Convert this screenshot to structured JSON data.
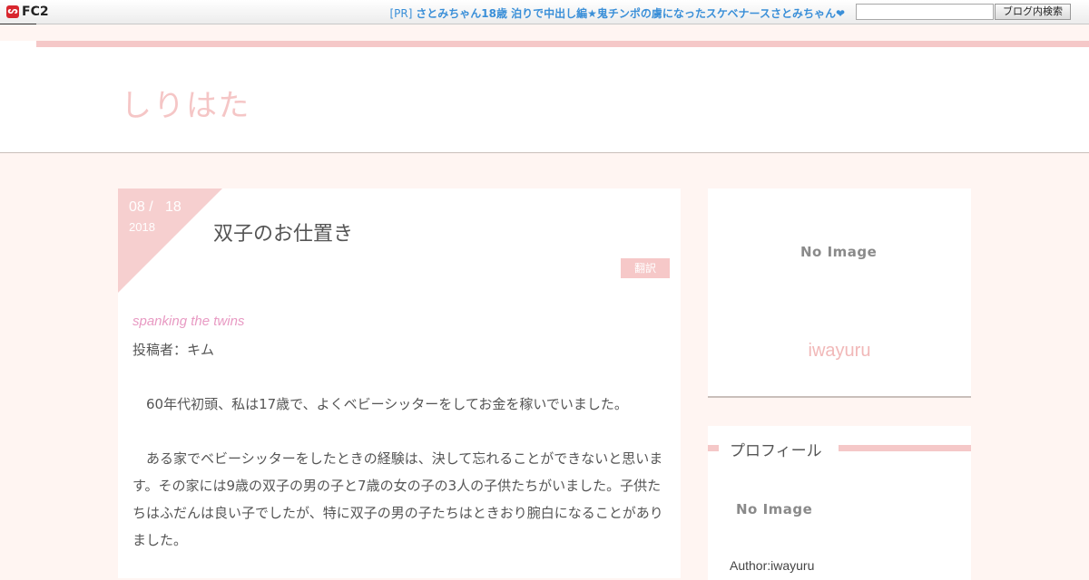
{
  "topbar": {
    "logo_text": "FC2",
    "pr_prefix": "[PR]",
    "pr_text": "さとみちゃん18歳 泊りで中出し編★鬼チンポの虜になったスケベナースさとみちゃん❤",
    "search_placeholder": "",
    "search_button": "ブログ内検索"
  },
  "header": {
    "site_title": "しりはた"
  },
  "article": {
    "date_month_day": "08 /   18",
    "date_year": "2018",
    "title": "双子のお仕置き",
    "category": "翻訳",
    "english_title": "spanking the twins",
    "posted_by": "投稿者：キム",
    "paragraph1": "　60年代初頭、私は17歳で、よくベビーシッターをしてお金を稼いでいました。",
    "paragraph2": "　ある家でベビーシッターをしたときの経験は、決して忘れることができないと思います。その家には9歳の双子の男の子と7歳の女の子の3人の子供たちがいました。子供たちはふだんは良い子でしたが、特に双子の男の子たちはときおり腕白になることがありました。"
  },
  "sidebar": {
    "no_image_label": "No Image",
    "author_display": "iwayuru",
    "profile_heading": "プロフィール",
    "profile_no_image": "No Image",
    "profile_author": "Author:iwayuru"
  },
  "colors": {
    "accent_pink": "#f6cfcf",
    "page_background": "#fff5f2",
    "link_blue": "#3a8fd8"
  }
}
